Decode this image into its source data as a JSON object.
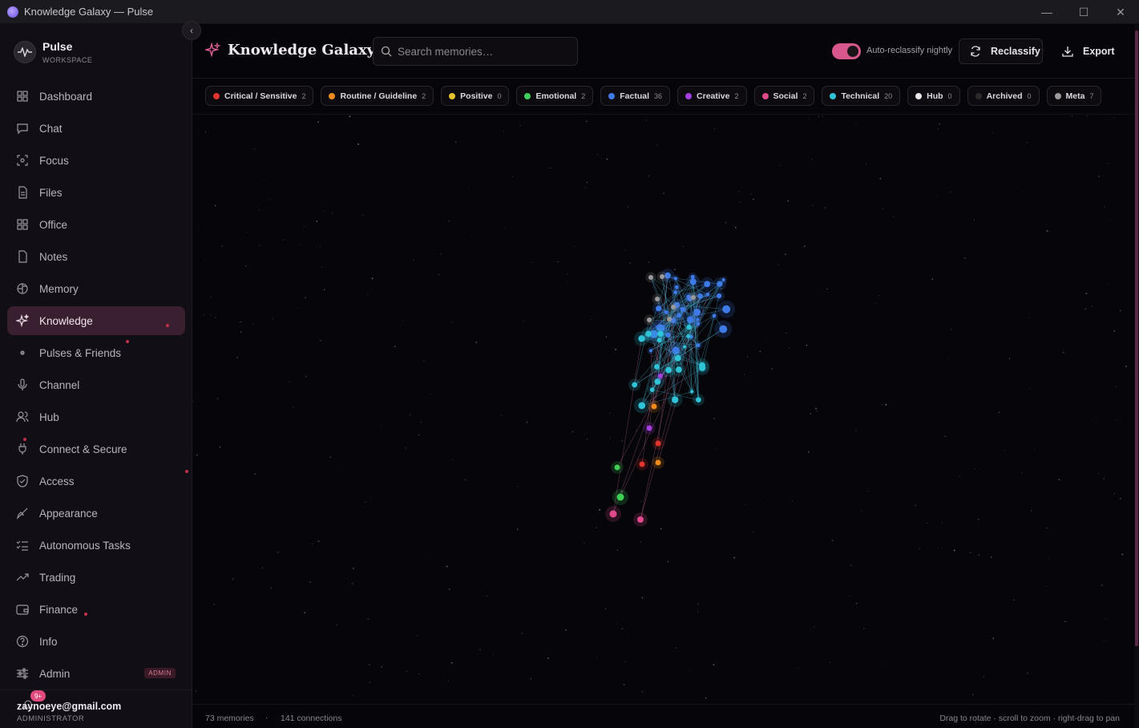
{
  "window": {
    "title": "Knowledge Galaxy — Pulse"
  },
  "brand": {
    "name": "Pulse",
    "subtitle": "WORKSPACE"
  },
  "sidebar": {
    "items": [
      {
        "label": "Dashboard",
        "icon": "dashboard-icon"
      },
      {
        "label": "Chat",
        "icon": "chat-icon"
      },
      {
        "label": "Focus",
        "icon": "focus-icon"
      },
      {
        "label": "Files",
        "icon": "file-icon"
      },
      {
        "label": "Office",
        "icon": "grid-icon"
      },
      {
        "label": "Notes",
        "icon": "note-icon"
      },
      {
        "label": "Memory",
        "icon": "brain-icon"
      },
      {
        "label": "Knowledge",
        "icon": "sparkle-icon",
        "active": true
      },
      {
        "label": "Pulses & Friends",
        "icon": "dot-icon"
      },
      {
        "label": "Channel",
        "icon": "mic-icon"
      },
      {
        "label": "Hub",
        "icon": "users-icon"
      },
      {
        "label": "Connect & Secure",
        "icon": "plug-icon"
      },
      {
        "label": "Access",
        "icon": "shield-icon"
      },
      {
        "label": "Appearance",
        "icon": "brush-icon"
      },
      {
        "label": "Autonomous Tasks",
        "icon": "tasks-icon"
      },
      {
        "label": "Trading",
        "icon": "trend-icon"
      },
      {
        "label": "Finance",
        "icon": "wallet-icon"
      },
      {
        "label": "Info",
        "icon": "help-icon"
      },
      {
        "label": "Admin",
        "icon": "sliders-icon",
        "badge": "ADMIN"
      }
    ]
  },
  "user": {
    "email": "zaynoeye@gmail.com",
    "role": "ADMINISTRATOR",
    "notifications": "9+"
  },
  "header": {
    "title": "Knowledge Galaxy",
    "search_placeholder": "Search memories…",
    "toggle_label": "Auto-reclassify nightly",
    "reclassify_label": "Reclassify",
    "export_label": "Export"
  },
  "categories": [
    {
      "label": "Critical / Sensitive",
      "count": "2",
      "color": "#e0342f"
    },
    {
      "label": "Routine / Guideline",
      "count": "2",
      "color": "#f08a1c"
    },
    {
      "label": "Positive",
      "count": "0",
      "color": "#e6c22a"
    },
    {
      "label": "Emotional",
      "count": "2",
      "color": "#3fce56"
    },
    {
      "label": "Factual",
      "count": "36",
      "color": "#3f7be8"
    },
    {
      "label": "Creative",
      "count": "2",
      "color": "#a53fe0"
    },
    {
      "label": "Social",
      "count": "2",
      "color": "#e04a8c"
    },
    {
      "label": "Technical",
      "count": "20",
      "color": "#2fc3d8"
    },
    {
      "label": "Hub",
      "count": "0",
      "color": "#e8e8e8"
    },
    {
      "label": "Archived",
      "count": "0",
      "color": "#2a2a2a"
    },
    {
      "label": "Meta",
      "count": "7",
      "color": "#9a9a9a"
    }
  ],
  "footer": {
    "memories": "73 memories",
    "separator": "·",
    "connections": "141 connections",
    "hint": "Drag to rotate · scroll to zoom · right-drag to pan"
  }
}
